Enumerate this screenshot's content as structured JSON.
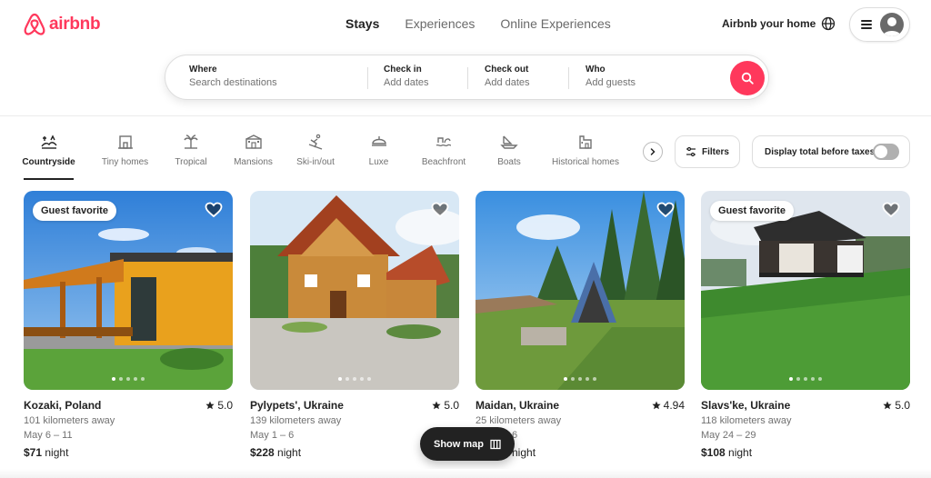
{
  "brand": {
    "name": "airbnb",
    "color": "#FF385C"
  },
  "nav": {
    "tabs": [
      "Stays",
      "Experiences",
      "Online Experiences"
    ],
    "active": "Stays"
  },
  "header": {
    "host_link": "Airbnb your home",
    "globe_icon": "globe-icon",
    "menu_icon": "menu-icon"
  },
  "search": {
    "where": {
      "label": "Where",
      "placeholder": "Search destinations"
    },
    "check_in": {
      "label": "Check in",
      "placeholder": "Add dates"
    },
    "check_out": {
      "label": "Check out",
      "placeholder": "Add dates"
    },
    "who": {
      "label": "Who",
      "placeholder": "Add guests"
    },
    "button_icon": "search-icon"
  },
  "categories": [
    {
      "label": "Countryside",
      "icon": "countryside-icon",
      "active": true
    },
    {
      "label": "Tiny homes",
      "icon": "tiny-home-icon"
    },
    {
      "label": "Tropical",
      "icon": "palm-tree-icon"
    },
    {
      "label": "Mansions",
      "icon": "mansion-icon"
    },
    {
      "label": "Ski-in/out",
      "icon": "skier-icon"
    },
    {
      "label": "Luxe",
      "icon": "luxe-icon"
    },
    {
      "label": "Beachfront",
      "icon": "beachfront-icon"
    },
    {
      "label": "Boats",
      "icon": "boat-icon"
    },
    {
      "label": "Historical homes",
      "icon": "historical-home-icon"
    }
  ],
  "filters": {
    "label": "Filters",
    "icon": "sliders-icon"
  },
  "tax_toggle": {
    "label": "Display total before taxes",
    "on": false
  },
  "listings": [
    {
      "badge": "Guest favorite",
      "title": "Kozaki, Poland",
      "rating": "5.0",
      "distance": "101 kilometers away",
      "dates": "May 6 – 11",
      "price": "$71",
      "unit": "night",
      "photo_index": 1,
      "photo_count": 5
    },
    {
      "badge": "",
      "title": "Pylypets', Ukraine",
      "rating": "5.0",
      "distance": "139 kilometers away",
      "dates": "May 1 – 6",
      "price": "$228",
      "unit": "night",
      "photo_index": 1,
      "photo_count": 5
    },
    {
      "badge": "",
      "title": "Maidan, Ukraine",
      "rating": "4.94",
      "distance": "25 kilometers away",
      "dates": "6",
      "price": "",
      "unit": "night",
      "photo_index": 1,
      "photo_count": 5
    },
    {
      "badge": "Guest favorite",
      "title": "Slavs'ke, Ukraine",
      "rating": "5.0",
      "distance": "118 kilometers away",
      "dates": "May 24 – 29",
      "price": "$108",
      "unit": "night",
      "photo_index": 1,
      "photo_count": 5
    }
  ],
  "show_map": {
    "label": "Show map",
    "icon": "map-icon"
  }
}
